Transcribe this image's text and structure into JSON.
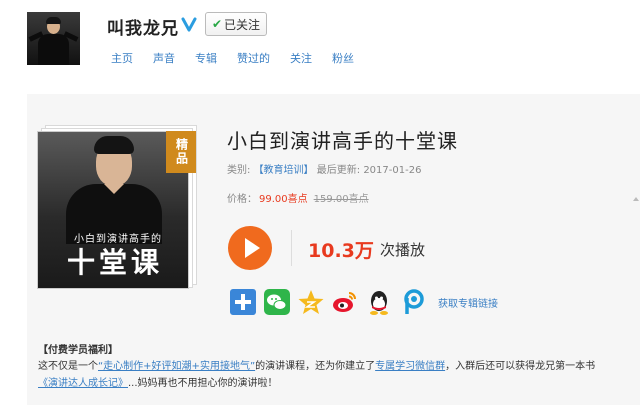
{
  "header": {
    "username": "叫我龙兄",
    "follow_label": "已关注",
    "nav": [
      "主页",
      "声音",
      "专辑",
      "赞过的",
      "关注",
      "粉丝"
    ]
  },
  "album": {
    "badge": "精品",
    "cover_subtitle": "小白到演讲高手的",
    "cover_title": "十堂课",
    "title": "小白到演讲高手的十堂课",
    "category_label": "类别:",
    "category": "【教育培训】",
    "updated_label": "最后更新:",
    "updated": "2017-01-26",
    "price_label": "价格：",
    "price": "99.00喜点",
    "original_price": "159.00喜点",
    "play_count": "10.3万",
    "play_count_label": "次播放",
    "share_link_label": "获取专辑链接"
  },
  "benefits": {
    "title": "【付费学员福利】",
    "line1_a": "这不仅是一个",
    "line1_b": "“走心制作+好评如潮+实用接地气”",
    "line1_c": "的演讲课程，还为你建立了",
    "line1_d": "专属学习微信群",
    "line1_e": "，入群后还可以获得龙兄第一本书",
    "line2_a": "《演讲达人成长记》",
    "line2_b": "...妈妈再也不用担心你的演讲啦！"
  },
  "colors": {
    "link": "#3a7fc4",
    "accent_orange": "#f06a1e",
    "price_red": "#e83a1f",
    "badge": "#d08a1d"
  }
}
